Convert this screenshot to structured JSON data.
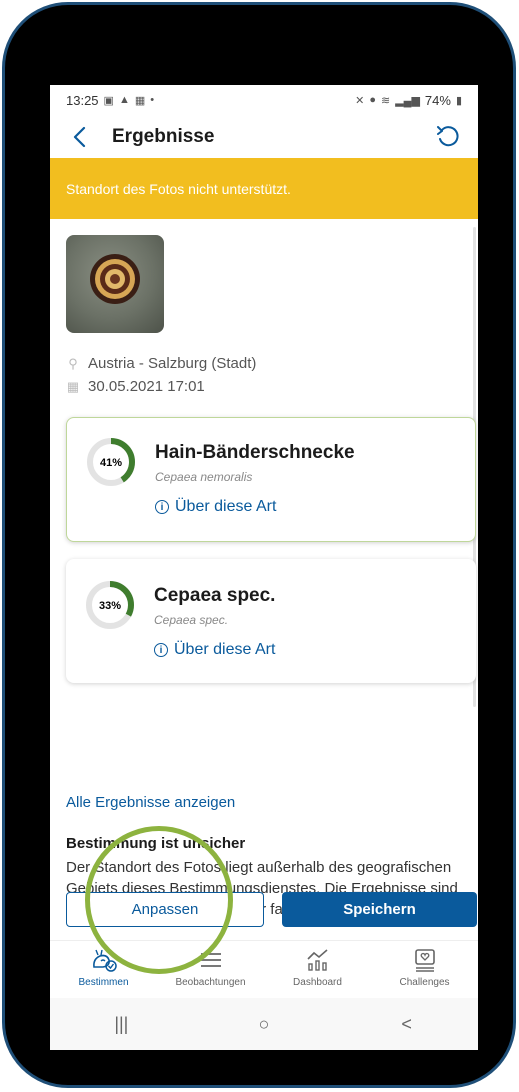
{
  "status_bar": {
    "time": "13:25",
    "battery": "74%"
  },
  "app_bar": {
    "title": "Ergebnisse"
  },
  "banner": {
    "text": "Standort des Fotos nicht unterstützt."
  },
  "photo_meta": {
    "location": "Austria - Salzburg (Stadt)",
    "datetime": "30.05.2021 17:01"
  },
  "results": [
    {
      "confidence_label": "41%",
      "confidence": 0.41,
      "name": "Hain-Bänderschnecke",
      "latin": "Cepaea nemoralis",
      "about_label": "Über diese Art"
    },
    {
      "confidence_label": "33%",
      "confidence": 0.33,
      "name": "Cepaea spec.",
      "latin": "Cepaea spec.",
      "about_label": "Über diese Art"
    }
  ],
  "all_results_link": "Alle Ergebnisse anzeigen",
  "warning": {
    "title": "Bestimmung ist unsicher",
    "text": "Der Standort des Fotos liegt außerhalb des geografischen Gebiets dieses Bestimmungsdienstes. Die Ergebnisse sind möglicherweise ungenau oder falsch."
  },
  "actions": {
    "adjust_label": "Anpassen",
    "save_label": "Speichern"
  },
  "bottom_nav": [
    {
      "label": "Bestimmen",
      "icon": "snail-icon"
    },
    {
      "label": "Beobachtungen",
      "icon": "list-icon"
    },
    {
      "label": "Dashboard",
      "icon": "chart-icon"
    },
    {
      "label": "Challenges",
      "icon": "challenge-icon"
    }
  ],
  "system_nav": {
    "recents": "|||",
    "home": "○",
    "back": "<"
  },
  "colors": {
    "primary": "#0a5a9c",
    "banner": "#f2be1f",
    "accent_green": "#3f7d2e",
    "highlight_ring": "#8db33f"
  }
}
